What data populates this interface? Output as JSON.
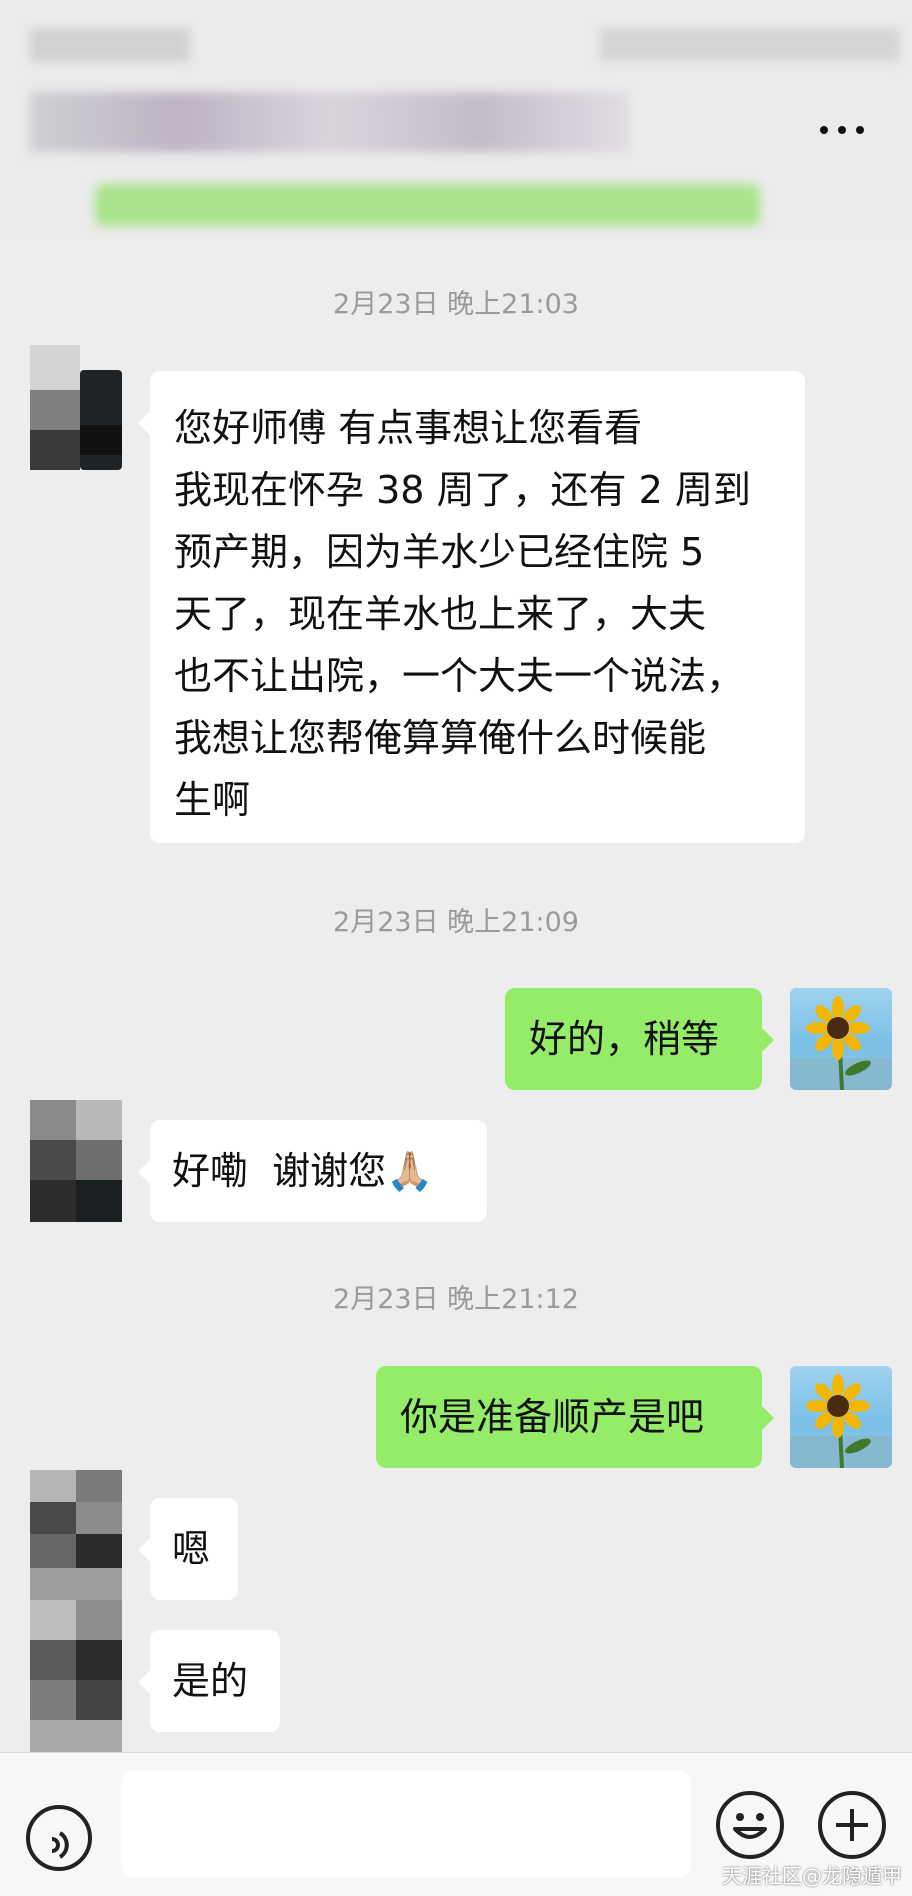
{
  "messages": {
    "ts1": "2月23日 晚上21:03",
    "msg1": "您好师傅 有点事想让您看看\n我现在怀孕 38 周了，还有 2 周到\n预产期，因为羊水少已经住院 5\n天了，现在羊水也上来了，大夫\n也不让出院，一个大夫一个说法，\n我想让您帮俺算算俺什么时候能\n生啊",
    "ts2": "2月23日 晚上21:09",
    "msg2": "好的，稍等",
    "msg3": "好嘞  谢谢您🙏🏼",
    "ts3": "2月23日 晚上21:12",
    "msg4": "你是准备顺产是吧",
    "msg5": "嗯",
    "msg6": "是的"
  },
  "watermark": "天涯社区@龙隐遁甲",
  "icons": {
    "more": "more-icon",
    "voice": "voice-icon",
    "emoji": "emoji-icon",
    "plus": "plus-icon"
  },
  "colors": {
    "background": "#ededed",
    "sent_bubble": "#95ec69",
    "received_bubble": "#ffffff"
  }
}
